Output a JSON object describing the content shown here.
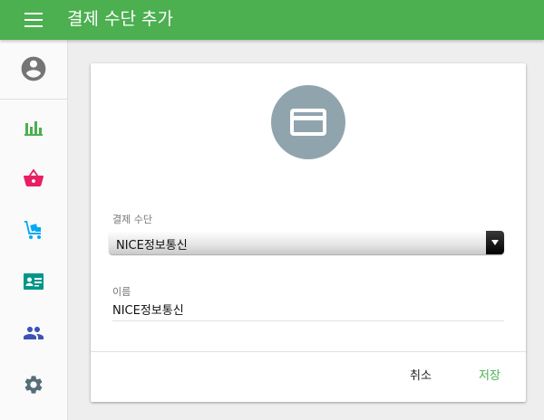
{
  "header": {
    "title": "결제 수단 추가"
  },
  "sidebar": {
    "items": [
      {
        "name": "statistics",
        "icon": "bar-chart-icon",
        "color": "#4caf50"
      },
      {
        "name": "shop",
        "icon": "basket-icon",
        "color": "#e91e63"
      },
      {
        "name": "delivery",
        "icon": "hand-truck-icon",
        "color": "#03a9f4"
      },
      {
        "name": "contacts",
        "icon": "contact-card-icon",
        "color": "#009688"
      },
      {
        "name": "users",
        "icon": "group-icon",
        "color": "#3f51b5"
      },
      {
        "name": "settings",
        "icon": "gear-icon",
        "color": "#546e7a"
      }
    ]
  },
  "form": {
    "icon": "credit-card-icon",
    "method_label": "결제 수단",
    "method_value": "NICE정보통신",
    "name_label": "이름",
    "name_value": "NICE정보통신"
  },
  "actions": {
    "cancel_label": "취소",
    "save_label": "저장"
  },
  "colors": {
    "primary": "#4caf50",
    "icon_circle": "#90a4ae"
  }
}
